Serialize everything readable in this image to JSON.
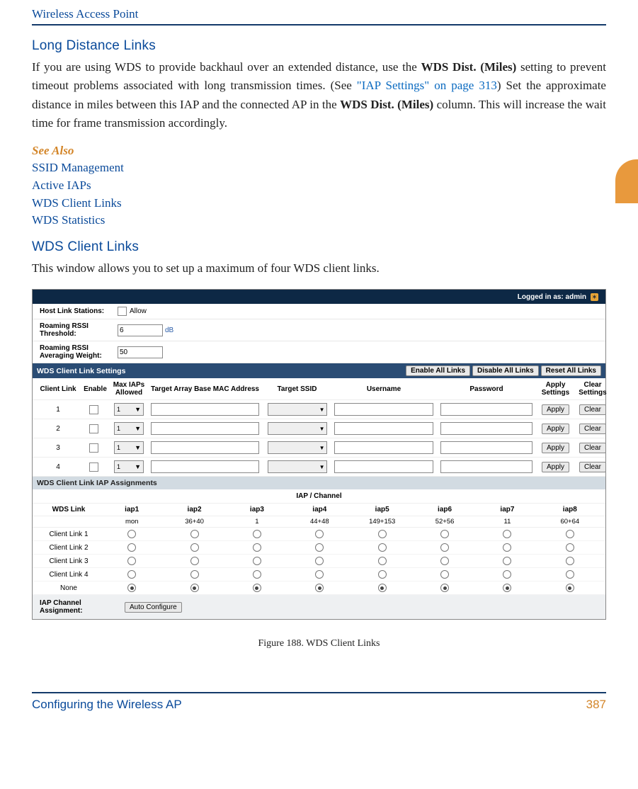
{
  "header": {
    "running": "Wireless Access Point"
  },
  "orange_tab": true,
  "sections": {
    "long_distance": {
      "title": "Long Distance Links",
      "para_pre": "If you are using WDS to provide backhaul over an extended distance, use the ",
      "bold1": "WDS Dist. (Miles)",
      "para_mid1": " setting to prevent timeout problems associated with long transmission times. (See ",
      "link1": "\"IAP Settings\" on page 313",
      "para_mid2": ") Set the approximate distance in miles between this IAP and the connected AP in the ",
      "bold2": "WDS Dist. (Miles)",
      "para_end": " column. This will increase the wait time for frame transmission accordingly."
    },
    "see_also": {
      "heading": "See Also",
      "links": [
        "SSID Management",
        "Active IAPs",
        "WDS Client Links",
        "WDS Statistics"
      ]
    },
    "wds_client": {
      "title": "WDS Client Links",
      "para": "This window allows you to set up a maximum of four WDS client links."
    }
  },
  "screenshot": {
    "topbar": {
      "status": "Logged in as: admin"
    },
    "host_link_stations": {
      "label": "Host Link Stations:",
      "option": "Allow"
    },
    "roaming_rssi_threshold": {
      "label": "Roaming RSSI Threshold:",
      "value": "6",
      "unit": "dB"
    },
    "roaming_rssi_avg": {
      "label": "Roaming RSSI Averaging Weight:",
      "value": "50"
    },
    "settings_band": {
      "title": "WDS Client Link Settings",
      "buttons": [
        "Enable All Links",
        "Disable All Links",
        "Reset All Links"
      ]
    },
    "columns": [
      "Client Link",
      "Enable",
      "Max IAPs Allowed",
      "Target Array Base MAC Address",
      "Target SSID",
      "Username",
      "Password",
      "Apply Settings",
      "Clear Settings"
    ],
    "rows": [
      {
        "id": "1",
        "max": "1",
        "apply": "Apply",
        "clear": "Clear"
      },
      {
        "id": "2",
        "max": "1",
        "apply": "Apply",
        "clear": "Clear"
      },
      {
        "id": "3",
        "max": "1",
        "apply": "Apply",
        "clear": "Clear"
      },
      {
        "id": "4",
        "max": "1",
        "apply": "Apply",
        "clear": "Clear"
      }
    ],
    "iap_band": {
      "title": "WDS Client Link IAP Assignments"
    },
    "iap_channel_header": "IAP / Channel",
    "wds_link_label": "WDS Link",
    "iaps": [
      {
        "name": "iap1",
        "ch": "mon"
      },
      {
        "name": "iap2",
        "ch": "36+40"
      },
      {
        "name": "iap3",
        "ch": "1"
      },
      {
        "name": "iap4",
        "ch": "44+48"
      },
      {
        "name": "iap5",
        "ch": "149+153"
      },
      {
        "name": "iap6",
        "ch": "52+56"
      },
      {
        "name": "iap7",
        "ch": "11"
      },
      {
        "name": "iap8",
        "ch": "60+64"
      }
    ],
    "link_rows": [
      "Client Link 1",
      "Client Link 2",
      "Client Link 3",
      "Client Link 4",
      "None"
    ],
    "iap_assignment": {
      "label": "IAP Channel Assignment:",
      "button": "Auto Configure"
    }
  },
  "figure_caption": "Figure 188. WDS Client Links",
  "footer": {
    "left": "Configuring the Wireless AP",
    "page": "387"
  }
}
